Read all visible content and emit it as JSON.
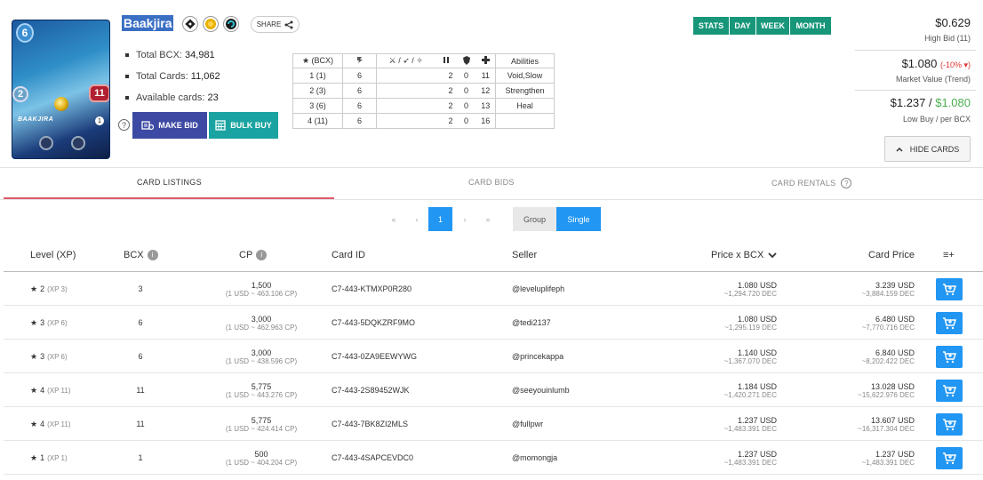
{
  "card": {
    "name": "Baakjira",
    "mana": "6",
    "speed": "2",
    "health": "11",
    "art_name": "BAAKJIRA",
    "art_level": "1",
    "share_label": "SHARE"
  },
  "summary": {
    "total_bcx_label": "Total BCX:",
    "total_bcx": "34,981",
    "total_cards_label": "Total Cards:",
    "total_cards": "11,062",
    "available_label": "Available cards:",
    "available": "23"
  },
  "actions": {
    "help": "?",
    "make_bid": "MAKE BID",
    "bulk_buy": "BULK BUY"
  },
  "levels": {
    "headers": [
      "★ (BCX)",
      "",
      "",
      "",
      "",
      "",
      "Abilities"
    ],
    "header_icons": [
      "level-star-icon",
      "speed-icon",
      "attack-types-icon",
      "armor-icon",
      "shield-icon",
      "health-icon"
    ],
    "header_extra": "⚔ / ➶ / ✧",
    "rows": [
      {
        "lvl": "1 (1)",
        "speed": "6",
        "attack": "",
        "armor": "2",
        "shield": "0",
        "health": "11",
        "ability": "Void,Slow"
      },
      {
        "lvl": "2 (3)",
        "speed": "6",
        "attack": "",
        "armor": "2",
        "shield": "0",
        "health": "12",
        "ability": "Strengthen"
      },
      {
        "lvl": "3 (6)",
        "speed": "6",
        "attack": "",
        "armor": "2",
        "shield": "0",
        "health": "13",
        "ability": "Heal"
      },
      {
        "lvl": "4 (11)",
        "speed": "6",
        "attack": "",
        "armor": "2",
        "shield": "0",
        "health": "16",
        "ability": ""
      }
    ]
  },
  "timeframes": [
    "STATS",
    "DAY",
    "WEEK",
    "MONTH"
  ],
  "prices": {
    "high_bid": "$0.629",
    "high_bid_label": "High Bid (11)",
    "market_value": "$1.080",
    "trend": "(-10% ▾)",
    "market_label": "Market Value (Trend)",
    "low_buy": "$1.237",
    "slash": " / ",
    "per_bcx": "$1.080",
    "low_label": "Low Buy / per BCX",
    "hide_cards": "HIDE CARDS"
  },
  "tabs": [
    "CARD LISTINGS",
    "CARD BIDS",
    "CARD RENTALS"
  ],
  "pagination": {
    "first": "«",
    "prev": "‹",
    "page": "1",
    "next": "›",
    "last": "»",
    "group": "Group",
    "single": "Single"
  },
  "listing": {
    "headers": {
      "level": "Level (XP)",
      "bcx": "BCX",
      "cp": "CP",
      "card_id": "Card ID",
      "seller": "Seller",
      "price": "Price x BCX",
      "card_price": "Card Price",
      "menu": "≡+"
    },
    "rows": [
      {
        "level": "2",
        "xp": "(XP 3)",
        "bcx": "3",
        "cp": "1,500",
        "cp_sub": "(1 USD ~ 463.106 CP)",
        "card_id": "C7-443-KTMXP0R280",
        "seller": "@leveluplifeph",
        "price": "1.080 USD",
        "price_dec": "~1,294.720 DEC",
        "card_price": "3.239 USD",
        "card_price_dec": "~3,884.159 DEC"
      },
      {
        "level": "3",
        "xp": "(XP 6)",
        "bcx": "6",
        "cp": "3,000",
        "cp_sub": "(1 USD ~ 462.963 CP)",
        "card_id": "C7-443-5DQKZRF9MO",
        "seller": "@tedi2137",
        "price": "1.080 USD",
        "price_dec": "~1,295.119 DEC",
        "card_price": "6.480 USD",
        "card_price_dec": "~7,770.716 DEC"
      },
      {
        "level": "3",
        "xp": "(XP 6)",
        "bcx": "6",
        "cp": "3,000",
        "cp_sub": "(1 USD ~ 438.596 CP)",
        "card_id": "C7-443-0ZA9EEWYWG",
        "seller": "@princekappa",
        "price": "1.140 USD",
        "price_dec": "~1,367.070 DEC",
        "card_price": "6.840 USD",
        "card_price_dec": "~8,202.422 DEC"
      },
      {
        "level": "4",
        "xp": "(XP 11)",
        "bcx": "11",
        "cp": "5,775",
        "cp_sub": "(1 USD ~ 443.276 CP)",
        "card_id": "C7-443-2S89452WJK",
        "seller": "@seeyouinlumb",
        "price": "1.184 USD",
        "price_dec": "~1,420.271 DEC",
        "card_price": "13.028 USD",
        "card_price_dec": "~15,622.976 DEC"
      },
      {
        "level": "4",
        "xp": "(XP 11)",
        "bcx": "11",
        "cp": "5,775",
        "cp_sub": "(1 USD ~ 424.414 CP)",
        "card_id": "C7-443-7BK8ZI2MLS",
        "seller": "@fullpwr",
        "price": "1.237 USD",
        "price_dec": "~1,483.391 DEC",
        "card_price": "13.607 USD",
        "card_price_dec": "~16,317.304 DEC"
      },
      {
        "level": "1",
        "xp": "(XP 1)",
        "bcx": "1",
        "cp": "500",
        "cp_sub": "(1 USD ~ 404.204 CP)",
        "card_id": "C7-443-4SAPCEVDC0",
        "seller": "@momongja",
        "price": "1.237 USD",
        "price_dec": "~1,483.391 DEC",
        "card_price": "1.237 USD",
        "card_price_dec": "~1,483.391 DEC"
      }
    ]
  }
}
